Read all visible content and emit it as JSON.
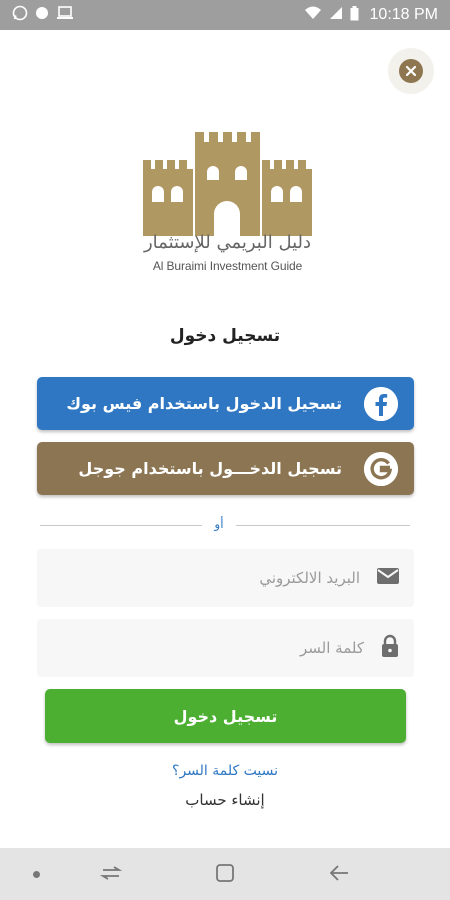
{
  "status_bar": {
    "time": "10:18 PM",
    "left_icons": [
      "whatsapp-icon",
      "circle-notification-icon",
      "laptop-icon"
    ],
    "right_icons": [
      "wifi-icon",
      "signal-icon",
      "battery-icon"
    ]
  },
  "logo": {
    "arabic_name": "دليل البريمي للإستثمار",
    "english_name": "Al Buraimi Investment Guide",
    "color": "#b09862"
  },
  "login": {
    "title": "تسجيل دخول",
    "facebook_label": "تسجيل الدخول باستخدام فيس بوك",
    "google_label": "تسجيل الدخـــول باستخدام جوجل",
    "or_label": "أو",
    "email_placeholder": "البريد الالكتروني",
    "password_placeholder": "كلمة السر",
    "submit_label": "تسجيل دخول",
    "forgot_password": "نسيت كلمة السر؟",
    "create_account": "إنشاء حساب"
  },
  "colors": {
    "facebook": "#2f77c3",
    "google_brown": "#8c7552",
    "login_green": "#4caf32",
    "link_blue": "#2f77c3"
  }
}
